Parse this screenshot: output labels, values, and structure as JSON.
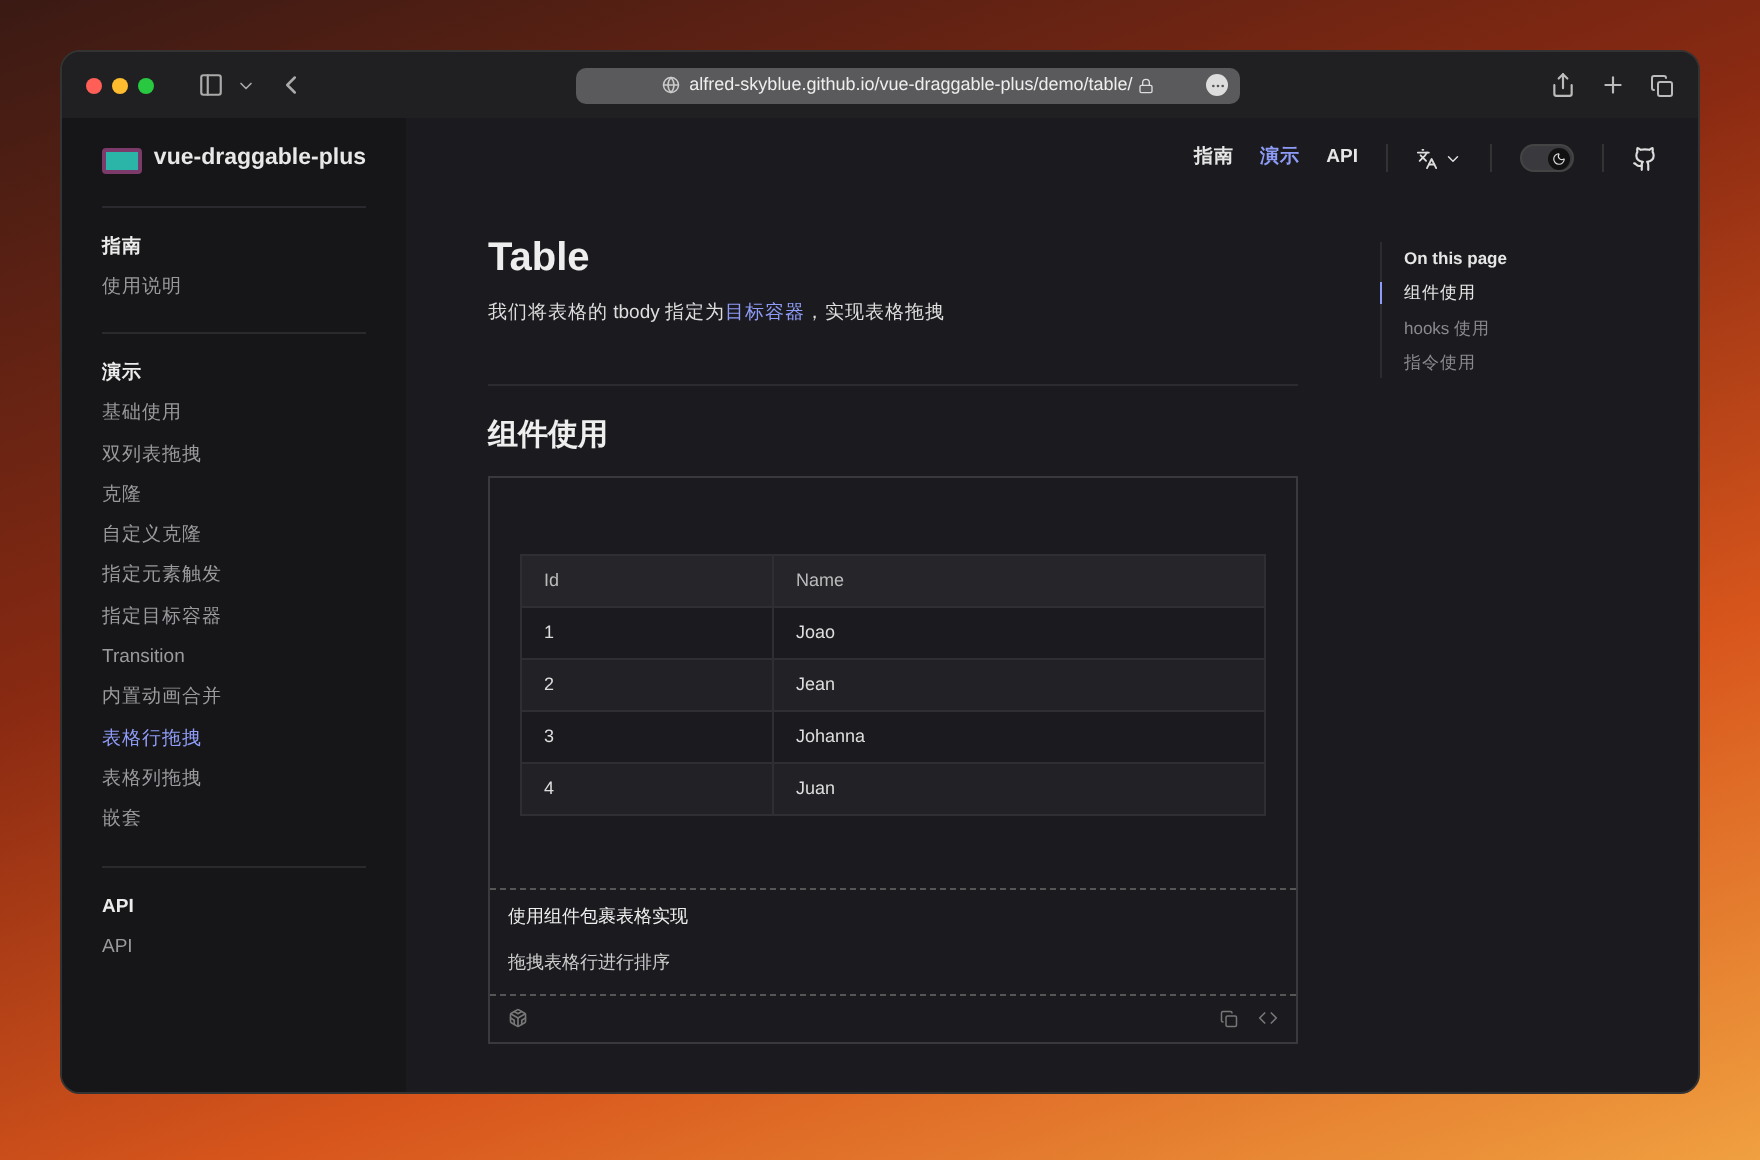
{
  "browser": {
    "url": "alfred-skyblue.github.io/vue-draggable-plus/demo/table/"
  },
  "sidebar": {
    "logo_text": "vue-draggable-plus",
    "groups": [
      {
        "title": "指南",
        "items": [
          {
            "label": "使用说明",
            "selected": false
          }
        ]
      },
      {
        "title": "演示",
        "items": [
          {
            "label": "基础使用",
            "selected": false
          },
          {
            "label": "双列表拖拽",
            "selected": false
          },
          {
            "label": "克隆",
            "selected": false
          },
          {
            "label": "自定义克隆",
            "selected": false
          },
          {
            "label": "指定元素触发",
            "selected": false
          },
          {
            "label": "指定目标容器",
            "selected": false
          },
          {
            "label": "Transition",
            "selected": false
          },
          {
            "label": "内置动画合并",
            "selected": false
          },
          {
            "label": "表格行拖拽",
            "selected": true
          },
          {
            "label": "表格列拖拽",
            "selected": false
          },
          {
            "label": "嵌套",
            "selected": false
          }
        ]
      },
      {
        "title": "API",
        "items": [
          {
            "label": "API",
            "selected": false
          }
        ]
      }
    ]
  },
  "nav": {
    "dark_mode": true,
    "items": [
      {
        "label": "指南",
        "selected": false
      },
      {
        "label": "演示",
        "selected": true
      },
      {
        "label": "API",
        "selected": false
      }
    ]
  },
  "content": {
    "title": "Table",
    "intro": {
      "before": "我们将表格的 tbody 指定为",
      "link": "目标容器",
      "after": "，实现表格拖拽"
    },
    "section_title": "组件使用",
    "table": {
      "columns": [
        "Id",
        "Name"
      ],
      "rows": [
        [
          "1",
          "Joao"
        ],
        [
          "2",
          "Jean"
        ],
        [
          "3",
          "Johanna"
        ],
        [
          "4",
          "Juan"
        ]
      ]
    },
    "demo_title": "使用组件包裹表格实现",
    "demo_description": "拖拽表格行进行排序"
  },
  "outline": {
    "title": "On this page",
    "items": [
      {
        "label": "组件使用",
        "selected": true
      },
      {
        "label": "hooks 使用",
        "selected": false
      },
      {
        "label": "指令使用",
        "selected": false
      }
    ]
  }
}
